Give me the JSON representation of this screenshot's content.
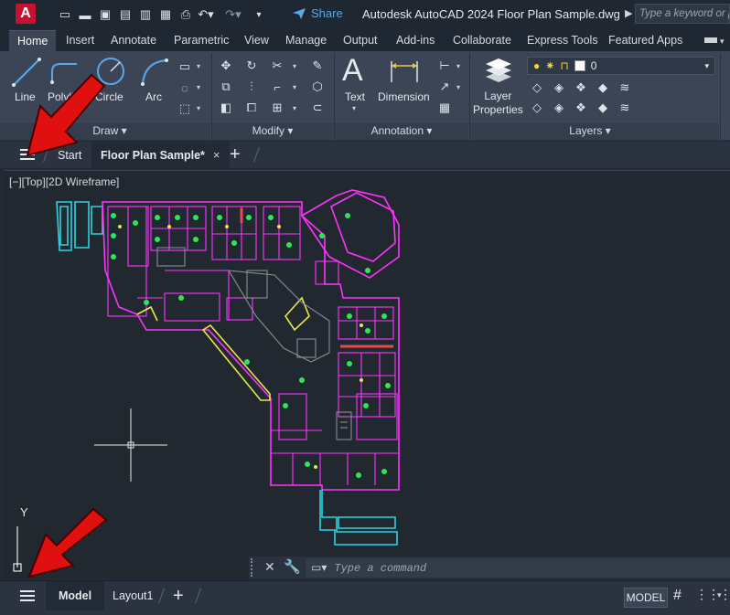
{
  "app": {
    "logo_letter": "A",
    "title": "Autodesk AutoCAD 2024   Floor Plan Sample.dwg",
    "share_label": "Share",
    "search_placeholder": "Type a keyword or phrase"
  },
  "quick_access": [
    "new-icon",
    "open-icon",
    "save-icon",
    "save-as-icon",
    "web-open-icon",
    "web-save-icon",
    "plot-icon",
    "undo-icon",
    "redo-icon",
    "customize-icon"
  ],
  "ribbon_tabs": [
    "Home",
    "Insert",
    "Annotate",
    "Parametric",
    "View",
    "Manage",
    "Output",
    "Add-ins",
    "Collaborate",
    "Express Tools",
    "Featured Apps"
  ],
  "ribbon": {
    "draw": {
      "title": "Draw",
      "tools": [
        "Line",
        "Polyline",
        "Circle",
        "Arc"
      ]
    },
    "modify": {
      "title": "Modify"
    },
    "annotation": {
      "title": "Annotation",
      "tools": [
        "Text",
        "Dimension"
      ]
    },
    "layers": {
      "title": "Layers",
      "layer_properties": "Layer\nProperties",
      "current_layer": "0"
    }
  },
  "file_tabs": {
    "start": "Start",
    "active": "Floor Plan Sample*",
    "close": "×",
    "add": "+"
  },
  "viewport": {
    "label": "[−][Top][2D Wireframe]",
    "ucs_y": "Y"
  },
  "command": {
    "placeholder": "Type a command"
  },
  "status": {
    "model_tab": "Model",
    "layout_tab": "Layout1",
    "add": "+",
    "model_button": "MODEL"
  },
  "colors": {
    "magenta": "#ff33ff",
    "cyan": "#2fd3e0",
    "yellow": "#e8e84a",
    "green": "#2ee65a",
    "red_arrow": "#e01010",
    "accent_blue": "#5aa9e6"
  }
}
